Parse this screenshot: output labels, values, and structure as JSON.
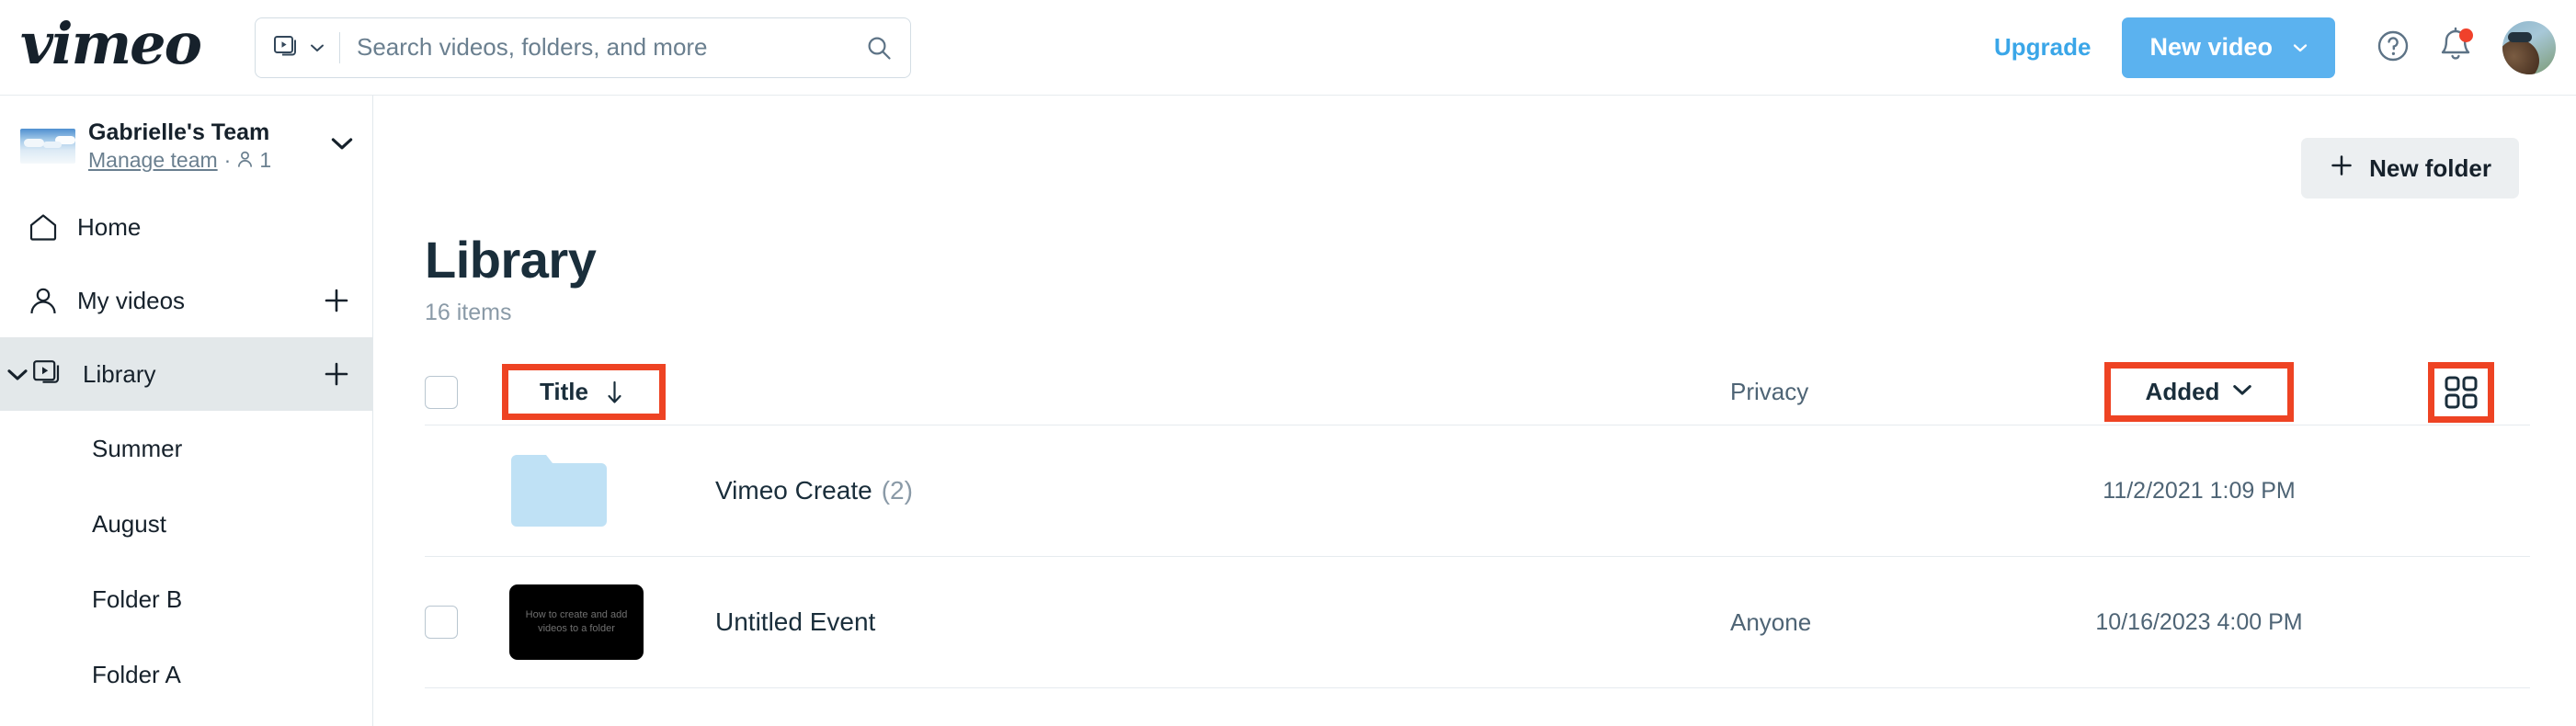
{
  "header": {
    "logo": "vimeo",
    "search": {
      "placeholder": "Search videos, folders, and more",
      "value": "",
      "type_icon": "video-stack-icon",
      "type_caret_icon": "chevron-down-icon",
      "submit_icon": "search-icon"
    },
    "upgrade_label": "Upgrade",
    "new_video_label": "New video",
    "new_video_caret_icon": "chevron-down-icon",
    "help_icon": "question-circle-icon",
    "notifications_icon": "bell-icon",
    "notifications_has_unread": true,
    "avatar_icon": "user-avatar"
  },
  "sidebar": {
    "team": {
      "name": "Gabrielle's Team",
      "manage_label": "Manage team",
      "separator": "·",
      "members_icon": "person-icon",
      "members_count": "1",
      "caret_icon": "chevron-down-icon",
      "thumb_icon": "sky-thumbnail"
    },
    "items": [
      {
        "label": "Home",
        "icon": "home-icon",
        "active": false,
        "has_plus": false,
        "expandable": false
      },
      {
        "label": "My videos",
        "icon": "person-icon",
        "active": false,
        "has_plus": true,
        "plus_icon": "plus-icon",
        "expandable": false
      },
      {
        "label": "Library",
        "icon": "video-stack-icon",
        "active": true,
        "has_plus": true,
        "plus_icon": "plus-icon",
        "expandable": true,
        "expander_icon": "chevron-down-icon"
      }
    ],
    "subitems": [
      {
        "label": "Summer"
      },
      {
        "label": "August"
      },
      {
        "label": "Folder B"
      },
      {
        "label": "Folder A"
      }
    ]
  },
  "main": {
    "new_folder_label": "New folder",
    "new_folder_plus_icon": "plus-icon",
    "page_title": "Library",
    "item_count": "16 items",
    "table": {
      "select_all_checkbox": "checkbox-unchecked",
      "columns": {
        "title": "Title",
        "title_sort_icon": "arrow-down-icon",
        "privacy": "Privacy",
        "added": "Added",
        "added_caret_icon": "chevron-down-icon",
        "grid_view_icon": "grid-view-icon"
      },
      "rows": [
        {
          "type": "folder",
          "thumb_icon": "folder-icon",
          "title": "Vimeo Create",
          "count": "(2)",
          "privacy": "",
          "added": "11/2/2021 1:09 PM",
          "has_checkbox": false
        },
        {
          "type": "video",
          "thumb_icon": "video-thumbnail",
          "thumb_text": "How to create and add videos to a folder",
          "title": "Untitled Event",
          "count": "",
          "privacy": "Anyone",
          "added": "10/16/2023 4:00 PM",
          "has_checkbox": true,
          "checkbox_state": "checkbox-unchecked"
        }
      ]
    }
  },
  "annotations": {
    "highlight_color": "#ee4323",
    "targets": [
      "title-column-header",
      "added-column-header",
      "grid-view-toggle"
    ]
  },
  "colors": {
    "accent_blue": "#5bb2ef",
    "link_blue": "#3aa6e8",
    "text_dark": "#1a2e3b",
    "text_muted": "#6a7f8f",
    "sidebar_active": "#e3e8ea",
    "folder_blue": "#bfe1f5"
  }
}
